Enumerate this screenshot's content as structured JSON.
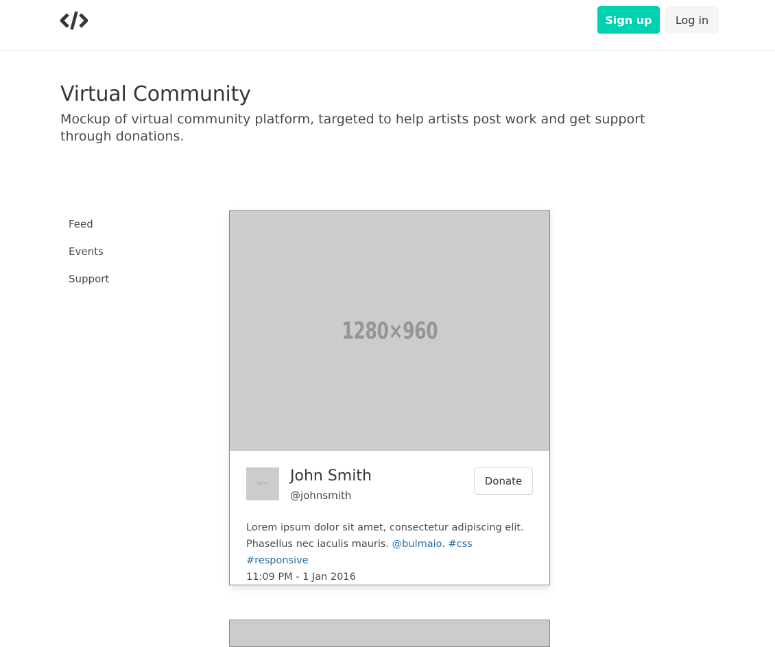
{
  "navbar": {
    "logo_icon": "code-brackets-icon",
    "signup_label": "Sign up",
    "login_label": "Log in",
    "accent": "#00d1b2"
  },
  "hero": {
    "title": "Virtual Community",
    "subtitle": "Mockup of virtual community platform, targeted to help artists post work and get support through donations."
  },
  "menu": {
    "items": [
      {
        "label": "Feed"
      },
      {
        "label": "Events"
      },
      {
        "label": "Support"
      }
    ]
  },
  "post": {
    "image_label": "1280×960",
    "avatar_label": "96×96",
    "author_name": "John Smith",
    "author_handle": "@johnsmith",
    "donate_label": "Donate",
    "text_line1": "Lorem ipsum dolor sit amet, consectetur adipiscing elit.",
    "text_line2_pre": "Phasellus nec iaculis mauris.",
    "mention": "@bulmaio",
    "sep": ".",
    "tag1": "#css",
    "tag2": "#responsive",
    "timestamp": "11:09 PM - 1 Jan 2016",
    "link_color": "#2a6fa3"
  }
}
